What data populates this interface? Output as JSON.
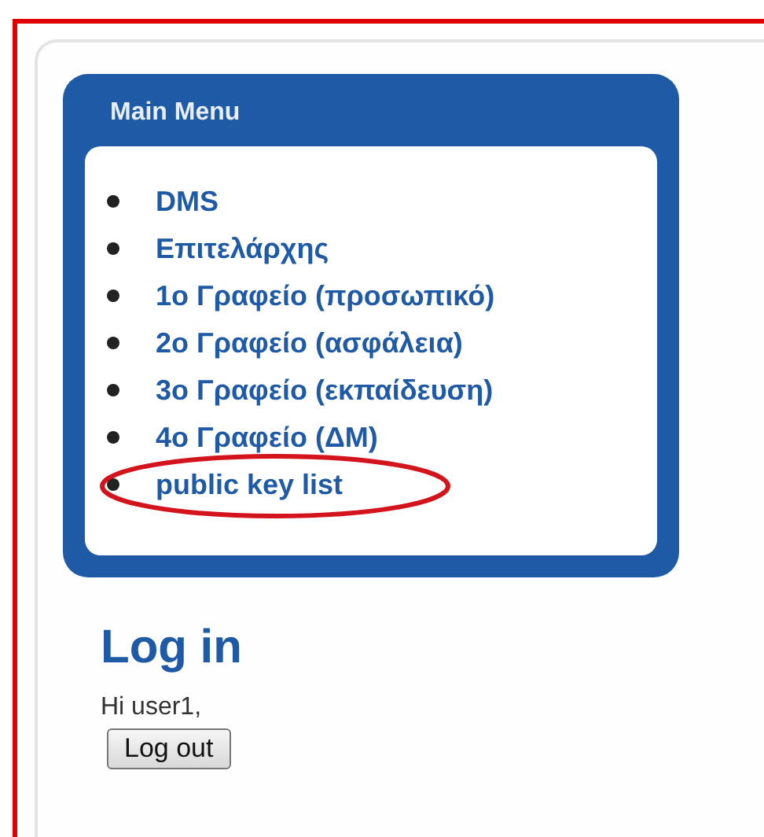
{
  "main_menu": {
    "title": "Main Menu",
    "items": [
      {
        "label": "DMS",
        "circled": false
      },
      {
        "label": "Επιτελάρχης",
        "circled": false
      },
      {
        "label": "1ο Γραφείο (προσωπικό)",
        "circled": false
      },
      {
        "label": "2ο Γραφείο (ασφάλεια)",
        "circled": false
      },
      {
        "label": "3ο Γραφείο (εκπαίδευση)",
        "circled": false
      },
      {
        "label": "4ο Γραφείο (ΔΜ)",
        "circled": false
      },
      {
        "label": "public key list",
        "circled": true
      }
    ]
  },
  "login": {
    "title": "Log in",
    "greeting": "Hi user1,",
    "button": "Log out"
  }
}
